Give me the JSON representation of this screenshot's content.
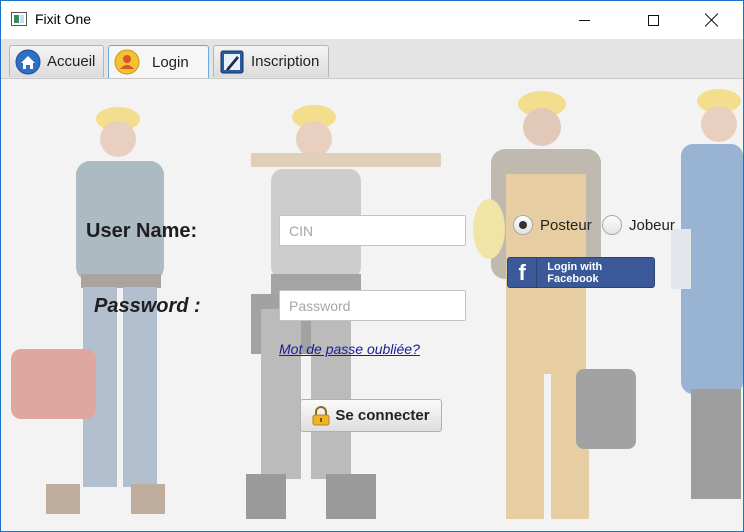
{
  "window": {
    "title": "Fixit One",
    "controls": [
      "minimize-icon",
      "maximize-icon",
      "close-icon"
    ]
  },
  "tabs": [
    {
      "label": "Accueil",
      "icon": "home-icon",
      "active": false
    },
    {
      "label": "Login",
      "icon": "user-icon",
      "active": true
    },
    {
      "label": "Inscription",
      "icon": "pencil-note-icon",
      "active": false
    }
  ],
  "login": {
    "username_label": "User Name:",
    "username_placeholder": "CIN",
    "username_value": "",
    "password_label": "Password :",
    "password_placeholder": "Password",
    "password_value": "",
    "forgot_link": "Mot de passe oubliée?",
    "connect_button": "Se connecter",
    "connect_icon": "lock-icon"
  },
  "role": {
    "options": [
      {
        "label": "Posteur",
        "selected": true
      },
      {
        "label": "Jobeur",
        "selected": false
      }
    ]
  },
  "facebook": {
    "icon_letter": "f",
    "label": "Login with Facebook",
    "color": "#3b5998"
  },
  "colors": {
    "accent": "#1a73c9",
    "link": "#1a1a9a",
    "background": "#f3f3f3"
  }
}
